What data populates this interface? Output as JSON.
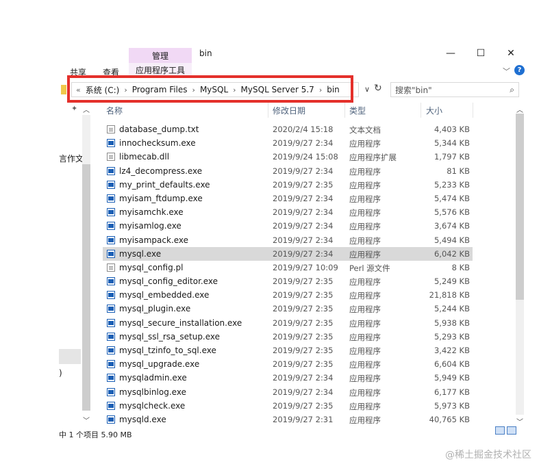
{
  "window": {
    "title": "bin",
    "manage_tab": "管理",
    "app_tools_tab": "应用程序工具",
    "ribbon_tabs": [
      "共享",
      "查看"
    ],
    "minimize": "—",
    "maximize": "☐",
    "close": "✕",
    "ribbon_toggle": "﹀",
    "help": "?"
  },
  "address": {
    "chevrons": "«",
    "crumbs": [
      "系统 (C:)",
      "Program Files",
      "MySQL",
      "MySQL Server 5.7",
      "bin"
    ],
    "separator": "›",
    "dropdown": "∨",
    "refresh": "↻"
  },
  "search": {
    "placeholder": "搜索\"bin\"",
    "icon": "⌕"
  },
  "nav_pane": {
    "fragment_doc": "言作文",
    "fragment_paren": ")",
    "pin": "📌",
    "scroll_up": "︿",
    "scroll_down": "﹀"
  },
  "columns": {
    "name": "名称",
    "date": "修改日期",
    "type": "类型",
    "size": "大小"
  },
  "files": [
    {
      "name": "database_dump.txt",
      "date": "2020/2/4 15:18",
      "type": "文本文档",
      "size": "4,403 KB",
      "icon": "doc"
    },
    {
      "name": "innochecksum.exe",
      "date": "2019/9/27 2:34",
      "type": "应用程序",
      "size": "5,344 KB",
      "icon": "exe"
    },
    {
      "name": "libmecab.dll",
      "date": "2019/9/24 15:08",
      "type": "应用程序扩展",
      "size": "1,797 KB",
      "icon": "doc"
    },
    {
      "name": "lz4_decompress.exe",
      "date": "2019/9/27 2:34",
      "type": "应用程序",
      "size": "81 KB",
      "icon": "exe"
    },
    {
      "name": "my_print_defaults.exe",
      "date": "2019/9/27 2:35",
      "type": "应用程序",
      "size": "5,233 KB",
      "icon": "exe"
    },
    {
      "name": "myisam_ftdump.exe",
      "date": "2019/9/27 2:34",
      "type": "应用程序",
      "size": "5,474 KB",
      "icon": "exe"
    },
    {
      "name": "myisamchk.exe",
      "date": "2019/9/27 2:34",
      "type": "应用程序",
      "size": "5,576 KB",
      "icon": "exe"
    },
    {
      "name": "myisamlog.exe",
      "date": "2019/9/27 2:34",
      "type": "应用程序",
      "size": "3,674 KB",
      "icon": "exe"
    },
    {
      "name": "myisampack.exe",
      "date": "2019/9/27 2:34",
      "type": "应用程序",
      "size": "5,494 KB",
      "icon": "exe"
    },
    {
      "name": "mysql.exe",
      "date": "2019/9/27 2:34",
      "type": "应用程序",
      "size": "6,042 KB",
      "icon": "exe",
      "selected": true
    },
    {
      "name": "mysql_config.pl",
      "date": "2019/9/27 10:09",
      "type": "Perl 源文件",
      "size": "8 KB",
      "icon": "doc"
    },
    {
      "name": "mysql_config_editor.exe",
      "date": "2019/9/27 2:35",
      "type": "应用程序",
      "size": "5,249 KB",
      "icon": "exe"
    },
    {
      "name": "mysql_embedded.exe",
      "date": "2019/9/27 2:35",
      "type": "应用程序",
      "size": "21,818 KB",
      "icon": "exe"
    },
    {
      "name": "mysql_plugin.exe",
      "date": "2019/9/27 2:35",
      "type": "应用程序",
      "size": "5,244 KB",
      "icon": "exe"
    },
    {
      "name": "mysql_secure_installation.exe",
      "date": "2019/9/27 2:35",
      "type": "应用程序",
      "size": "5,938 KB",
      "icon": "exe"
    },
    {
      "name": "mysql_ssl_rsa_setup.exe",
      "date": "2019/9/27 2:35",
      "type": "应用程序",
      "size": "5,293 KB",
      "icon": "exe"
    },
    {
      "name": "mysql_tzinfo_to_sql.exe",
      "date": "2019/9/27 2:35",
      "type": "应用程序",
      "size": "3,422 KB",
      "icon": "exe"
    },
    {
      "name": "mysql_upgrade.exe",
      "date": "2019/9/27 2:35",
      "type": "应用程序",
      "size": "6,604 KB",
      "icon": "exe"
    },
    {
      "name": "mysqladmin.exe",
      "date": "2019/9/27 2:34",
      "type": "应用程序",
      "size": "5,949 KB",
      "icon": "exe"
    },
    {
      "name": "mysqlbinlog.exe",
      "date": "2019/9/27 2:34",
      "type": "应用程序",
      "size": "6,177 KB",
      "icon": "exe"
    },
    {
      "name": "mysqlcheck.exe",
      "date": "2019/9/27 2:35",
      "type": "应用程序",
      "size": "5,973 KB",
      "icon": "exe"
    },
    {
      "name": "mysqld.exe",
      "date": "2019/9/27 2:31",
      "type": "应用程序",
      "size": "40,765 KB",
      "icon": "exe"
    }
  ],
  "status": {
    "text": "中 1 个项目  5.90 MB"
  },
  "watermark": "@稀土掘金技术社区",
  "colors": {
    "highlight": "#e4302b",
    "manage_tab": "#f1d9f5",
    "selected_row": "#d9d9d9"
  }
}
